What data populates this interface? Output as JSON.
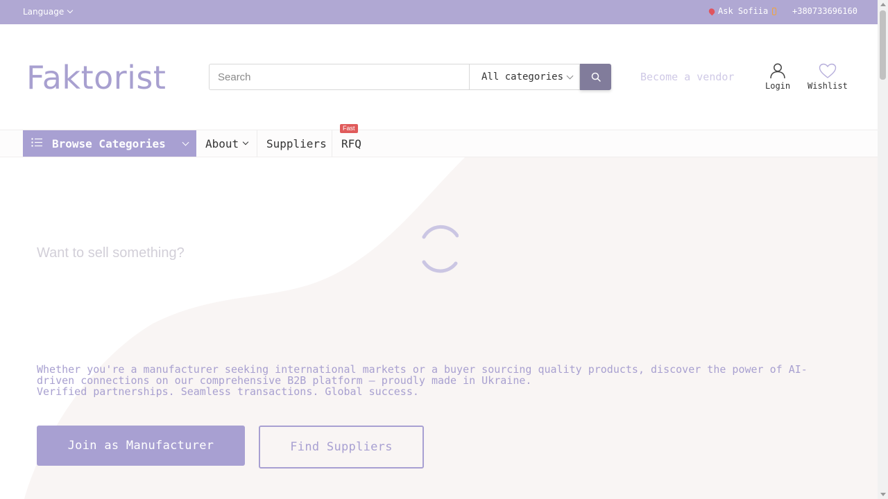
{
  "topbar": {
    "language_label": "Language",
    "ask_label": "Ask Sofiia",
    "phone": "+380733696160",
    "background_color": "#b0a8d3"
  },
  "header": {
    "logo_text": "Faktorist",
    "search": {
      "placeholder": "Search",
      "value": ""
    },
    "category_select": {
      "selected": "All categories"
    },
    "vendor_link": "Become a vendor",
    "login_label": "Login",
    "wishlist_label": "Wishlist",
    "icons": [
      "search-icon",
      "user-icon",
      "heart-icon"
    ]
  },
  "nav": {
    "browse_label": "Browse Categories",
    "items": [
      {
        "label": "About",
        "has_dropdown": true
      },
      {
        "label": "Suppliers"
      },
      {
        "label": "RFQ",
        "badge": "Fast"
      }
    ],
    "accent_color": "#a8a0d2"
  },
  "hero": {
    "title": "Want to sell something?",
    "description_lines": [
      "Whether you're a manufacturer seeking international markets or a buyer sourcing quality products, discover the power of AI-",
      "driven connections on our comprehensive B2B platform – proudly made in Ukraine.",
      "Verified partnerships. Seamless transactions. Global success."
    ],
    "primary_button": "Join as Manufacturer",
    "secondary_button": "Find Suppliers"
  }
}
